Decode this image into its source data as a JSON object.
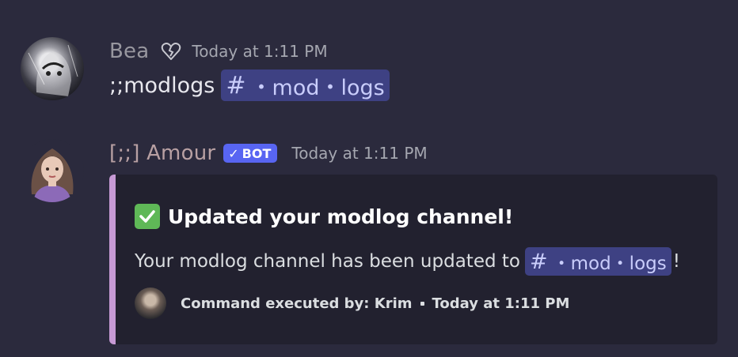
{
  "messages": [
    {
      "author": "Bea",
      "timestamp": "Today at 1:11 PM",
      "content_text": ";;modlogs",
      "channel_mention": "・mod・logs",
      "hash": "#"
    },
    {
      "author": "[;;] Amour",
      "bot_badge": "BOT",
      "bot_check": "✓",
      "timestamp": "Today at 1:11 PM",
      "embed": {
        "accent_color": "#c79ad5",
        "title": "Updated your modlog channel!",
        "description_text": "Your modlog channel has been updated to",
        "description_suffix": "!",
        "channel_mention": "・mod・logs",
        "hash": "#",
        "footer_text": "Command executed by: Krim",
        "footer_timestamp": "Today at 1:11 PM"
      }
    }
  ],
  "icons": {
    "status": "broken-heart-icon",
    "check": "white-check-mark-icon"
  },
  "colors": {
    "background": "#2b2a3d",
    "mention_bg": "#3e4183",
    "bot_badge": "#5865f2"
  }
}
